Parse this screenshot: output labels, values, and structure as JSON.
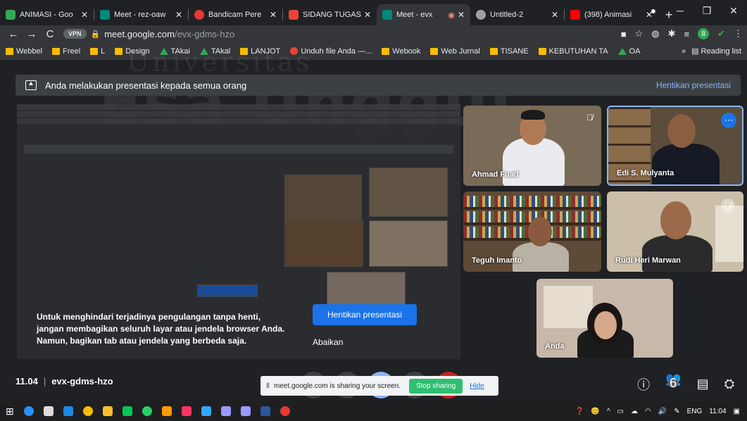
{
  "browser": {
    "tabs": [
      {
        "label": "ANIMASI - Goo",
        "favicon_color": "#34a853"
      },
      {
        "label": "Meet - rez-oaw",
        "favicon_color": "#00897b"
      },
      {
        "label": "Bandicam Pere",
        "favicon_color": "#e53935"
      },
      {
        "label": "SIDANG TUGAS",
        "favicon_color": "#ea4335"
      },
      {
        "label": "Meet - evx",
        "favicon_color": "#00897b",
        "active": true
      },
      {
        "label": "Untitled-2",
        "favicon_color": "#9aa0a6"
      },
      {
        "label": "(398) Animasi",
        "favicon_color": "#ff0000"
      }
    ],
    "address": {
      "vpn_label": "VPN",
      "domain": "meet.google.com",
      "path": "/evx-gdms-hzo"
    },
    "bookmarks": [
      "Webbel",
      "Freel",
      "L",
      "Design",
      "TAkai",
      "TAkal",
      "LANJOT",
      "Unduh file Anda —...",
      "Webook",
      "Web Jurnal",
      "TISANE",
      "KEBUTUHAN TA",
      "OA"
    ],
    "reading_list": "Reading list"
  },
  "watermark": {
    "line1": "Universitas",
    "line2": "Esa Unggul"
  },
  "meet": {
    "banner_text": "Anda melakukan presentasi kepada semua orang",
    "banner_action": "Hentikan presentasi",
    "participants": [
      {
        "name": "Ahmad Fuad",
        "muted": true
      },
      {
        "name": "Edi S. Mulyanta",
        "muted": false
      },
      {
        "name": "Teguh Imanto",
        "muted": false
      },
      {
        "name": "Rudi Heri Marwan",
        "muted": true
      },
      {
        "name": "Anda",
        "muted": false
      }
    ],
    "prompt": {
      "text": "Untuk menghindari terjadinya pengulangan tanpa henti, jangan membagikan seluruh layar atau jendela browser Anda. Namun, bagikan tab atau jendela yang berbeda saja.",
      "primary_button": "Hentikan presentasi",
      "dismiss_button": "Abaikan"
    },
    "bottom": {
      "time": "11.04",
      "meeting_code": "evx-gdms-hzo",
      "participant_count": "6"
    },
    "sharing_bar": {
      "text": "meet.google.com is sharing your screen.",
      "stop": "Stop sharing",
      "hide": "Hide"
    }
  },
  "taskbar": {
    "language": "ENG",
    "clock": "11:04"
  }
}
